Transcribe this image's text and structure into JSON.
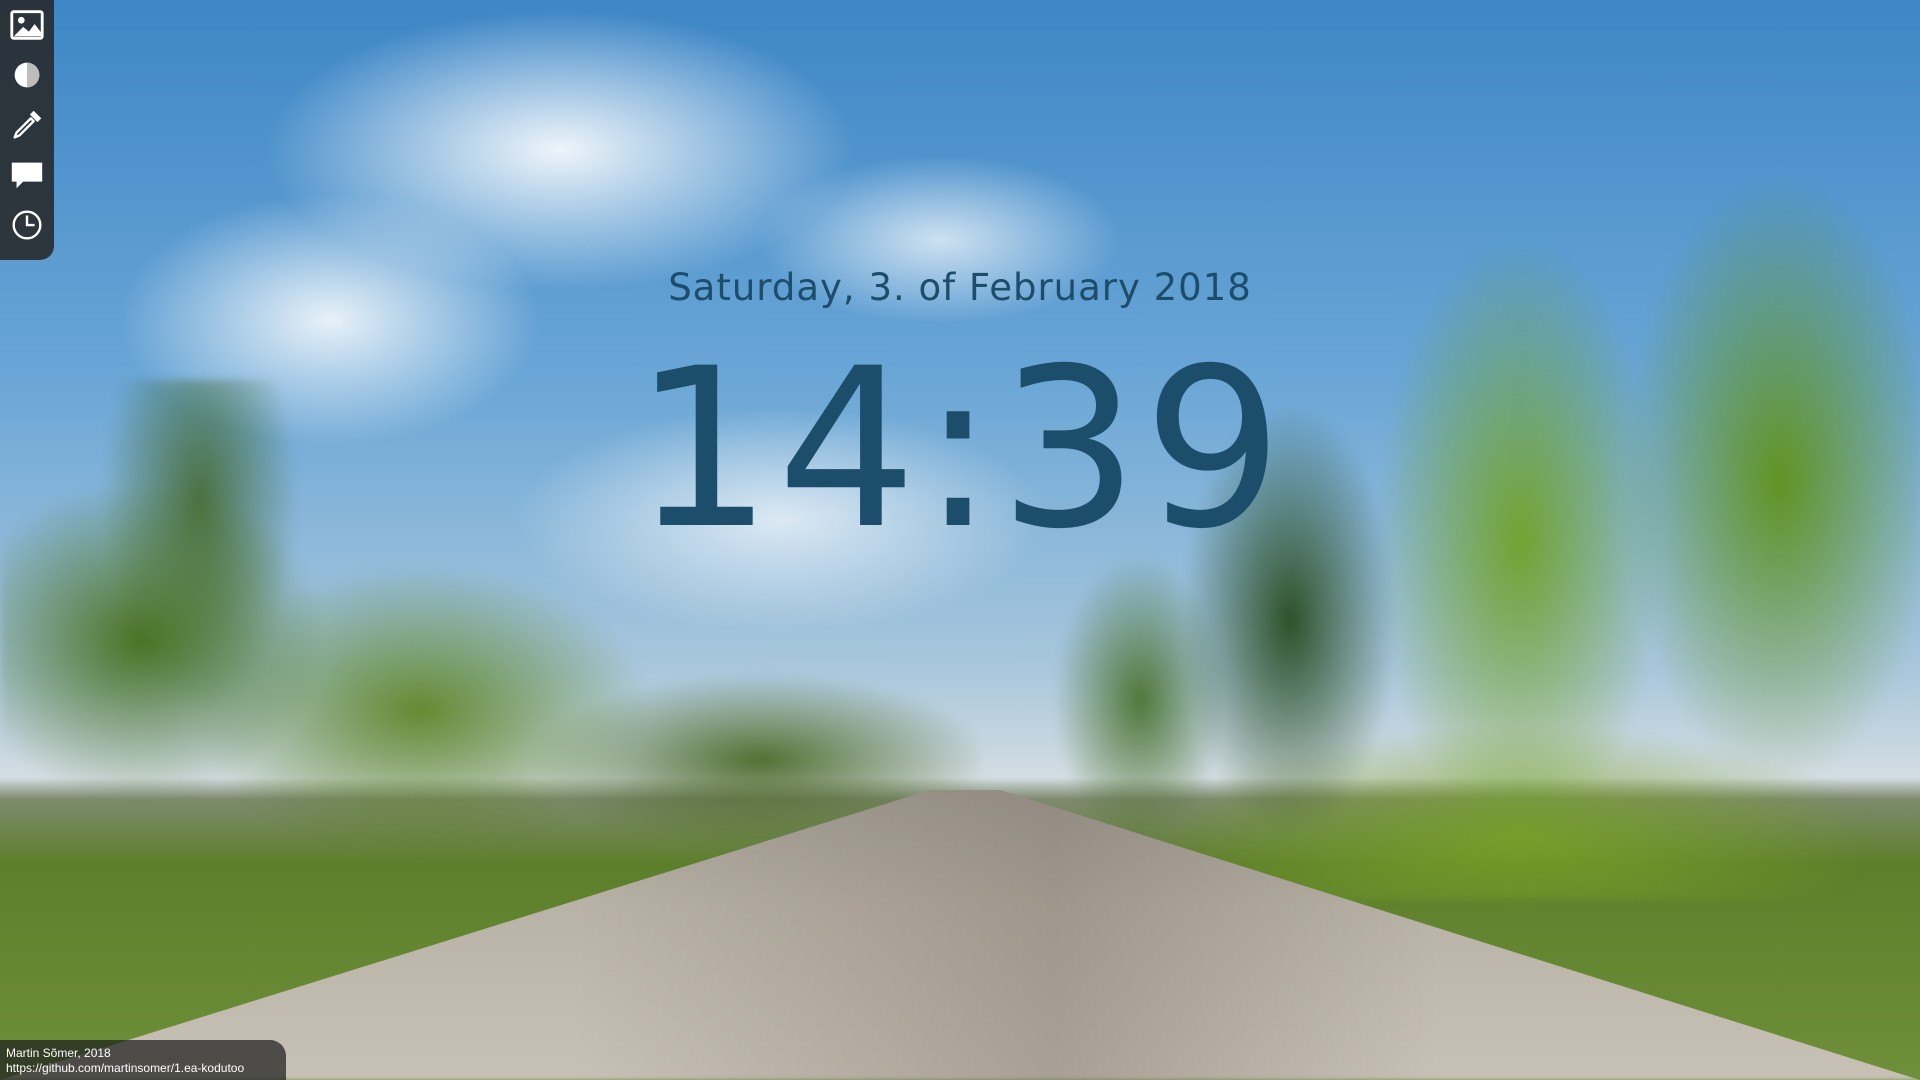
{
  "toolbar": {
    "items": [
      {
        "name": "image-icon"
      },
      {
        "name": "contrast-icon"
      },
      {
        "name": "eyedropper-icon"
      },
      {
        "name": "speech-bubble-icon"
      },
      {
        "name": "clock-icon"
      }
    ]
  },
  "clock": {
    "date": "Saturday, 3. of February 2018",
    "time": "14:39",
    "color": "#1c4d6a"
  },
  "credits": {
    "author": "Martin Sõmer, 2018",
    "url": "https://github.com/martinsomer/1.ea-kodutoo"
  }
}
